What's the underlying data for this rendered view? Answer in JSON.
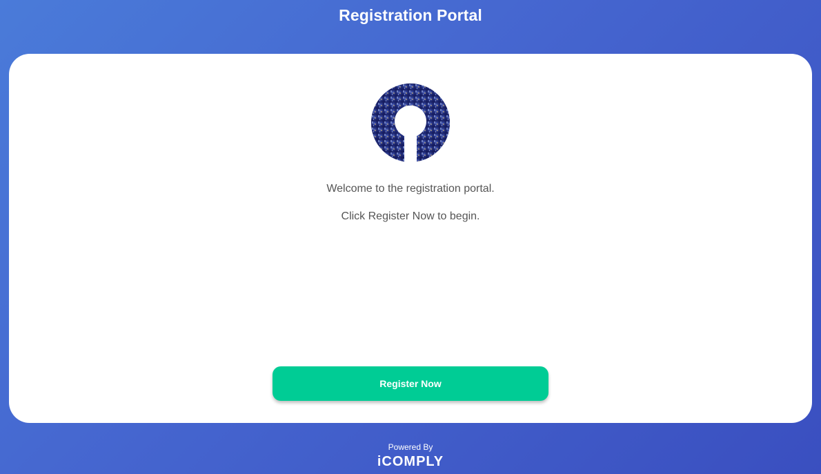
{
  "header": {
    "title": "Registration Portal"
  },
  "card": {
    "logo_icon": "keyhole-city-logo-icon",
    "welcome_text": "Welcome to the registration portal.",
    "instruction_text": "Click Register Now to begin.",
    "register_label": "Register Now"
  },
  "footer": {
    "powered_by": "Powered By",
    "brand": "iCOMPLY"
  },
  "colors": {
    "background_gradient": [
      "#4a7bd9",
      "#3a4fc0"
    ],
    "card": "#ffffff",
    "button": "#00cc95",
    "body_text": "#555555"
  }
}
